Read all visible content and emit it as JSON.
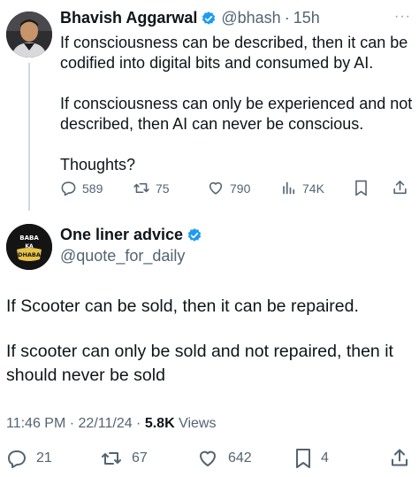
{
  "colors": {
    "text": "#0f1419",
    "secondary": "#536471",
    "verified": "#1d9bf0",
    "divider": "#cfd9de"
  },
  "tweet1": {
    "author_name": "Bhavish Aggarwal",
    "handle": "@bhash",
    "separator": "·",
    "time": "15h",
    "more": "···",
    "lines": [
      "If consciousness can be described, then it can be",
      "codified into digital bits and consumed by AI.",
      "",
      "If consciousness can only be experienced and not",
      "described, then AI can never be conscious.",
      "",
      "Thoughts?"
    ],
    "replies": "589",
    "reposts": "75",
    "likes": "790",
    "views": "74K"
  },
  "tweet2": {
    "author_name": "One liner advice",
    "handle": "@quote_for_daily",
    "avatar_text": "BABA KA DHABA",
    "lines": [
      "If Scooter can be sold, then it can be repaired.",
      "",
      "If scooter can only be sold and not repaired, then it",
      "should never be sold"
    ],
    "timestamp": "11:46 PM · 22/11/24 · ",
    "views_count": "5.8K",
    "views_label": " Views",
    "replies": "21",
    "reposts": "67",
    "likes": "642",
    "bookmarks": "4"
  }
}
